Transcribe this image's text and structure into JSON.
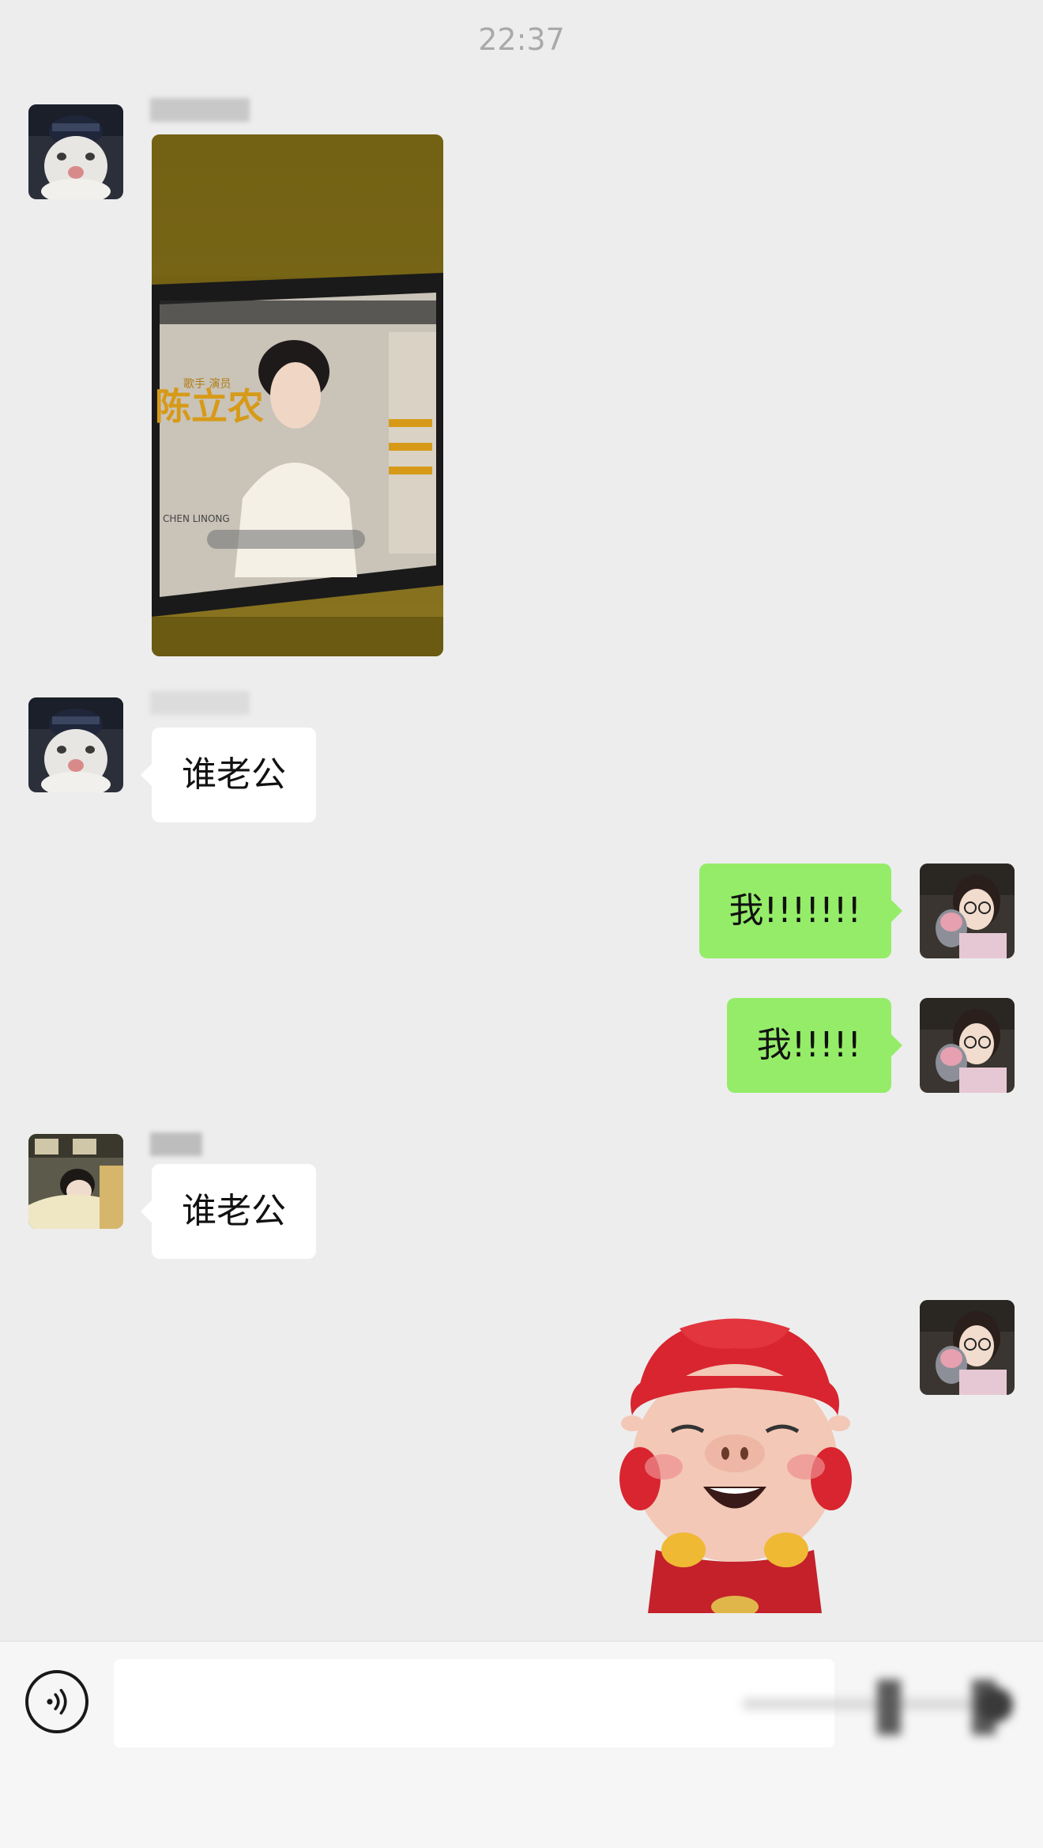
{
  "chat": {
    "timestamp": "22:37",
    "messages": [
      {
        "sender": "contact-1",
        "type": "image"
      },
      {
        "sender": "contact-1",
        "type": "text",
        "text": "谁老公"
      },
      {
        "sender": "me",
        "type": "text",
        "text": "我!!!!!!!"
      },
      {
        "sender": "me",
        "type": "text",
        "text": "我!!!!!"
      },
      {
        "sender": "contact-2",
        "type": "text",
        "text": "谁老公"
      },
      {
        "sender": "me",
        "type": "sticker"
      }
    ]
  },
  "photo": {
    "screen_text_name": "陈立农",
    "screen_text_roles": "歌手 演员",
    "screen_text_latin": "CHEN LINONG"
  },
  "input_bar": {
    "voice_icon": "voice-icon",
    "placeholder": ""
  },
  "colors": {
    "background": "#ededed",
    "incoming_bubble": "#ffffff",
    "outgoing_bubble": "#95ec69",
    "timestamp": "#a9a9a9"
  }
}
